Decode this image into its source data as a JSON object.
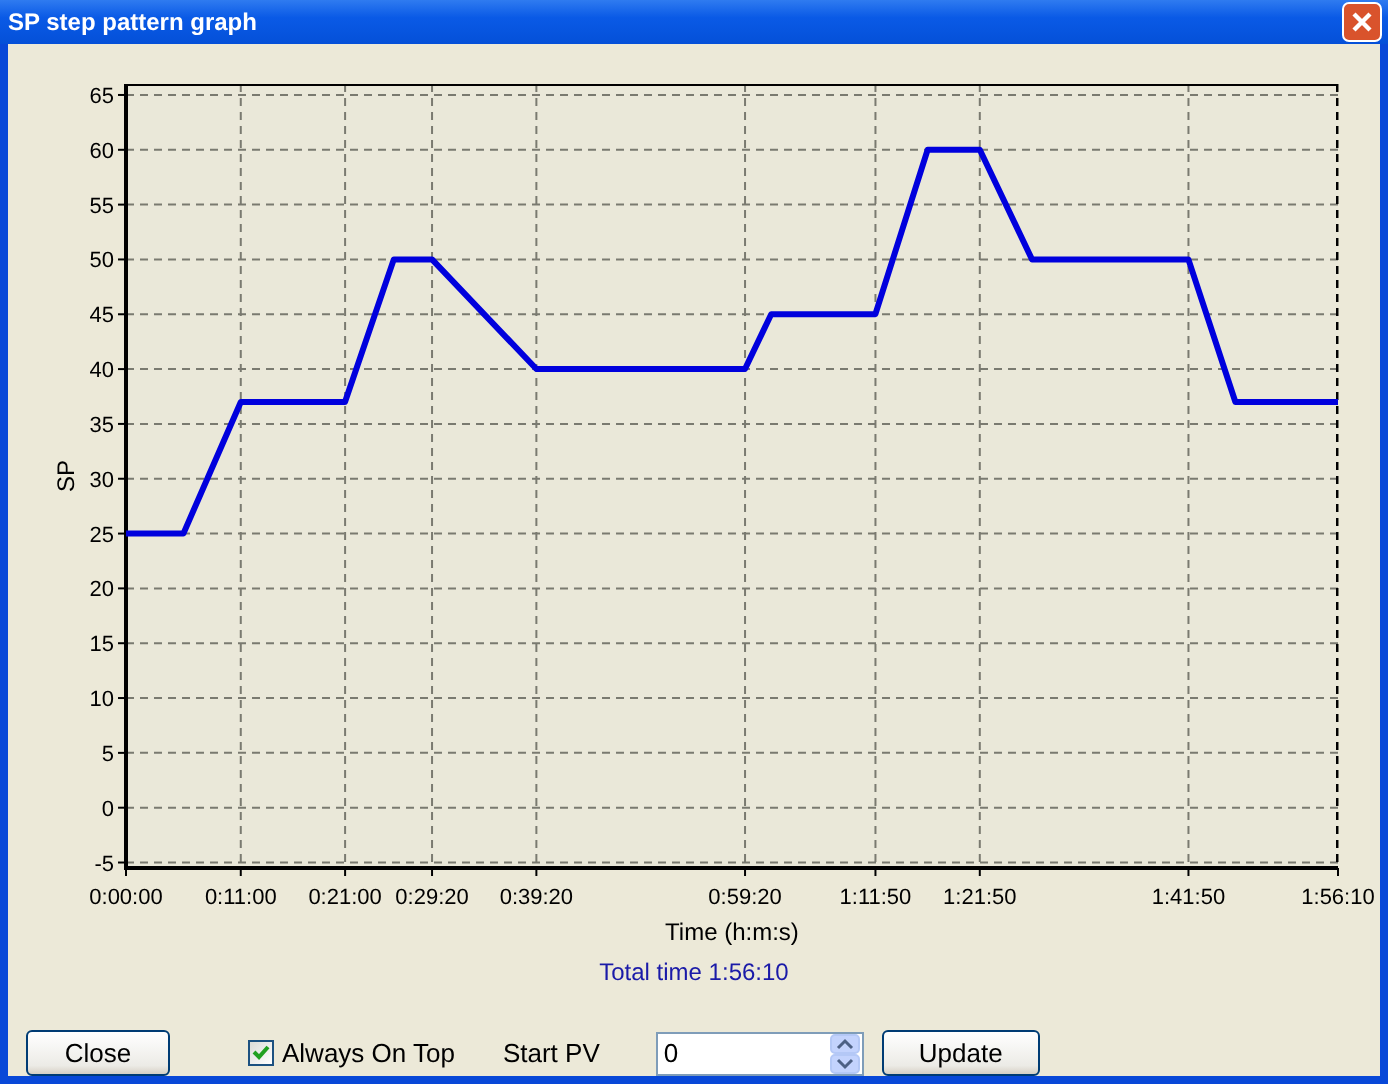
{
  "window": {
    "title": "SP step pattern graph"
  },
  "chart": {
    "chart_data": {
      "type": "line",
      "xlabel": "Time (h:m:s)",
      "ylabel": "SP",
      "x": [
        0,
        330,
        660,
        1260,
        1540,
        1760,
        2360,
        3560,
        3710,
        4310,
        4610,
        4910,
        5210,
        6110,
        6380,
        6970
      ],
      "series": [
        {
          "color": "#0000dd",
          "values": [
            25,
            25,
            37,
            37,
            50,
            50,
            40,
            40,
            45,
            45,
            60,
            60,
            50,
            50,
            37,
            37
          ]
        }
      ],
      "xlim": [
        0,
        6970
      ],
      "ylim": [
        -5.5,
        66
      ],
      "xticks": [
        {
          "value": 0,
          "label": "0:00:00"
        },
        {
          "value": 660,
          "label": "0:11:00"
        },
        {
          "value": 1260,
          "label": "0:21:00"
        },
        {
          "value": 1760,
          "label": "0:29:20"
        },
        {
          "value": 2360,
          "label": "0:39:20"
        },
        {
          "value": 3560,
          "label": "0:59:20"
        },
        {
          "value": 4310,
          "label": "1:11:50"
        },
        {
          "value": 4910,
          "label": "1:21:50"
        },
        {
          "value": 6110,
          "label": "1:41:50"
        },
        {
          "value": 6970,
          "label": "1:56:10"
        }
      ],
      "yticks": [
        -5,
        0,
        5,
        10,
        15,
        20,
        25,
        30,
        35,
        40,
        45,
        50,
        55,
        60,
        65
      ],
      "grid": true
    }
  },
  "total_time": "Total time 1:56:10",
  "controls": {
    "close_button": "Close",
    "always_on_top": {
      "label": "Always On Top",
      "checked": true
    },
    "start_pv": {
      "label": "Start PV",
      "value": "0"
    },
    "update_button": "Update"
  }
}
